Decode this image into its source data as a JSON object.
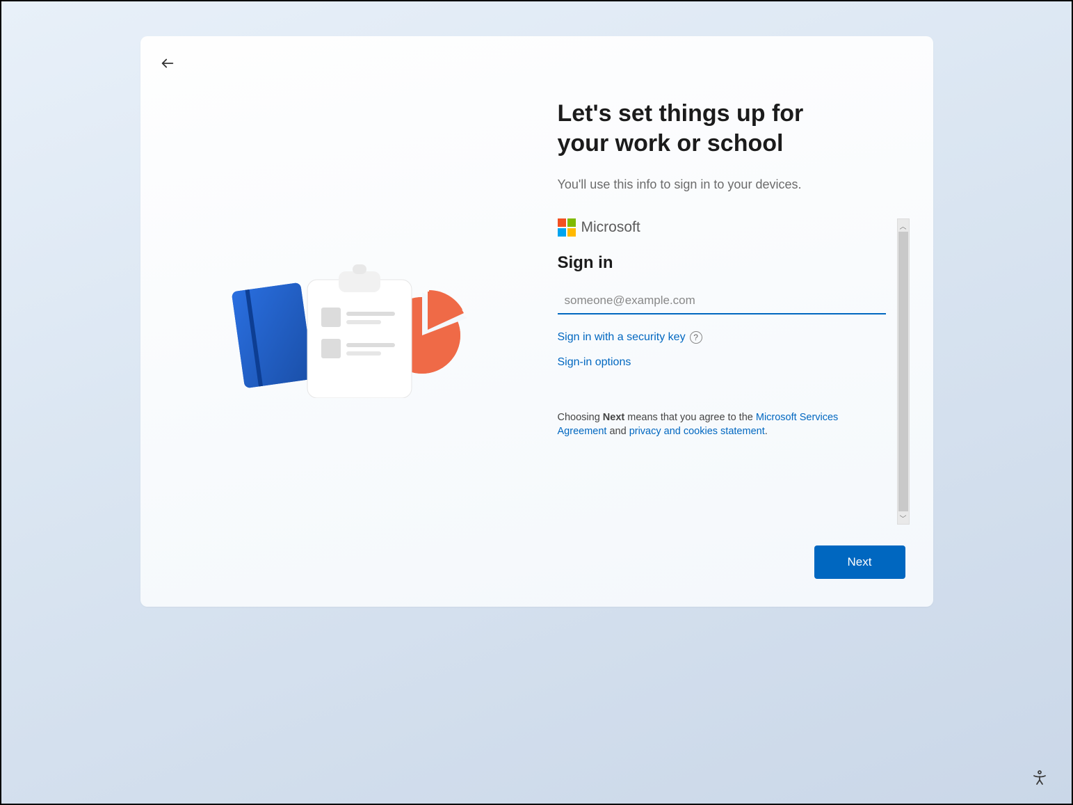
{
  "header": {
    "title": "Let's set things up for your work or school",
    "subtitle": "You'll use this info to sign in to your devices."
  },
  "brand": {
    "name": "Microsoft"
  },
  "signin": {
    "heading": "Sign in",
    "email_placeholder": "someone@example.com",
    "email_value": "",
    "security_key_link": "Sign in with a security key",
    "options_link": "Sign-in options"
  },
  "legal": {
    "prefix": "Choosing ",
    "bold_word": "Next",
    "middle": " means that you agree to the ",
    "services_link": "Microsoft Services Agreement",
    "and": " and ",
    "privacy_link": "privacy and cookies statement",
    "suffix": "."
  },
  "buttons": {
    "next": "Next"
  }
}
